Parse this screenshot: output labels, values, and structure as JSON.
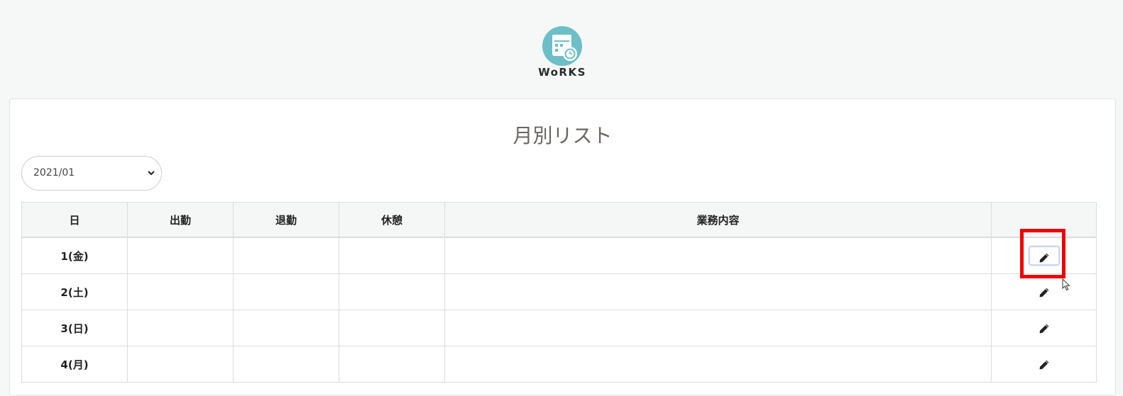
{
  "app": {
    "logo_text": "WoRKS",
    "logo_color": "#6cbfc7"
  },
  "card": {
    "title": "月別リスト"
  },
  "month_select": {
    "value": "2021/01"
  },
  "table": {
    "headers": [
      "日",
      "出勤",
      "退勤",
      "休憩",
      "業務内容",
      ""
    ],
    "rows": [
      {
        "day": "1(金)",
        "clock_in": "",
        "clock_out": "",
        "break": "",
        "work": ""
      },
      {
        "day": "2(土)",
        "clock_in": "",
        "clock_out": "",
        "break": "",
        "work": ""
      },
      {
        "day": "3(日)",
        "clock_in": "",
        "clock_out": "",
        "break": "",
        "work": ""
      },
      {
        "day": "4(月)",
        "clock_in": "",
        "clock_out": "",
        "break": "",
        "work": ""
      }
    ]
  },
  "icons": {
    "edit": "pencil-icon",
    "select_arrow": "chevron-down-icon",
    "logo": "calendar-clock-icon"
  },
  "colors": {
    "highlight": "#ee0000",
    "title": "#6c6461"
  }
}
